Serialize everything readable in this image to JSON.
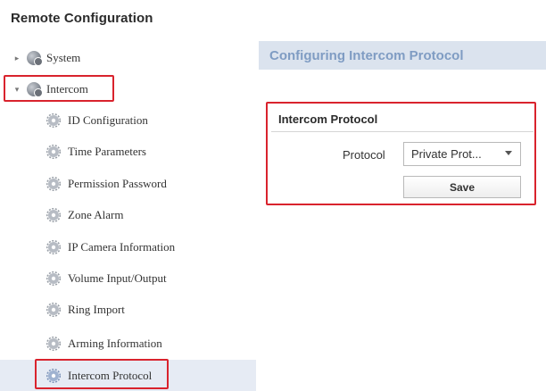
{
  "app": {
    "title": "Remote Configuration"
  },
  "sidebar": {
    "items": [
      {
        "label": "System",
        "icon": "globe-icon",
        "expanded": false
      },
      {
        "label": "Intercom",
        "icon": "globe-icon",
        "expanded": true,
        "children": [
          {
            "label": "ID Configuration"
          },
          {
            "label": "Time Parameters"
          },
          {
            "label": "Permission Password"
          },
          {
            "label": "Zone Alarm"
          },
          {
            "label": "IP Camera Information"
          },
          {
            "label": "Volume Input/Output"
          },
          {
            "label": "Ring Import"
          },
          {
            "label": "Arming Information"
          },
          {
            "label": "Intercom Protocol",
            "selected": true
          }
        ]
      }
    ]
  },
  "main": {
    "title": "Configuring Intercom Protocol",
    "section": {
      "title": "Intercom Protocol",
      "protocol_label": "Protocol",
      "protocol_value": "Private Prot...",
      "save_label": "Save"
    }
  },
  "colors": {
    "header_bg": "#dbe3ee",
    "header_text": "#7f9cc3",
    "selected_bg": "#e6ebf4",
    "callout": "#d9232d"
  }
}
